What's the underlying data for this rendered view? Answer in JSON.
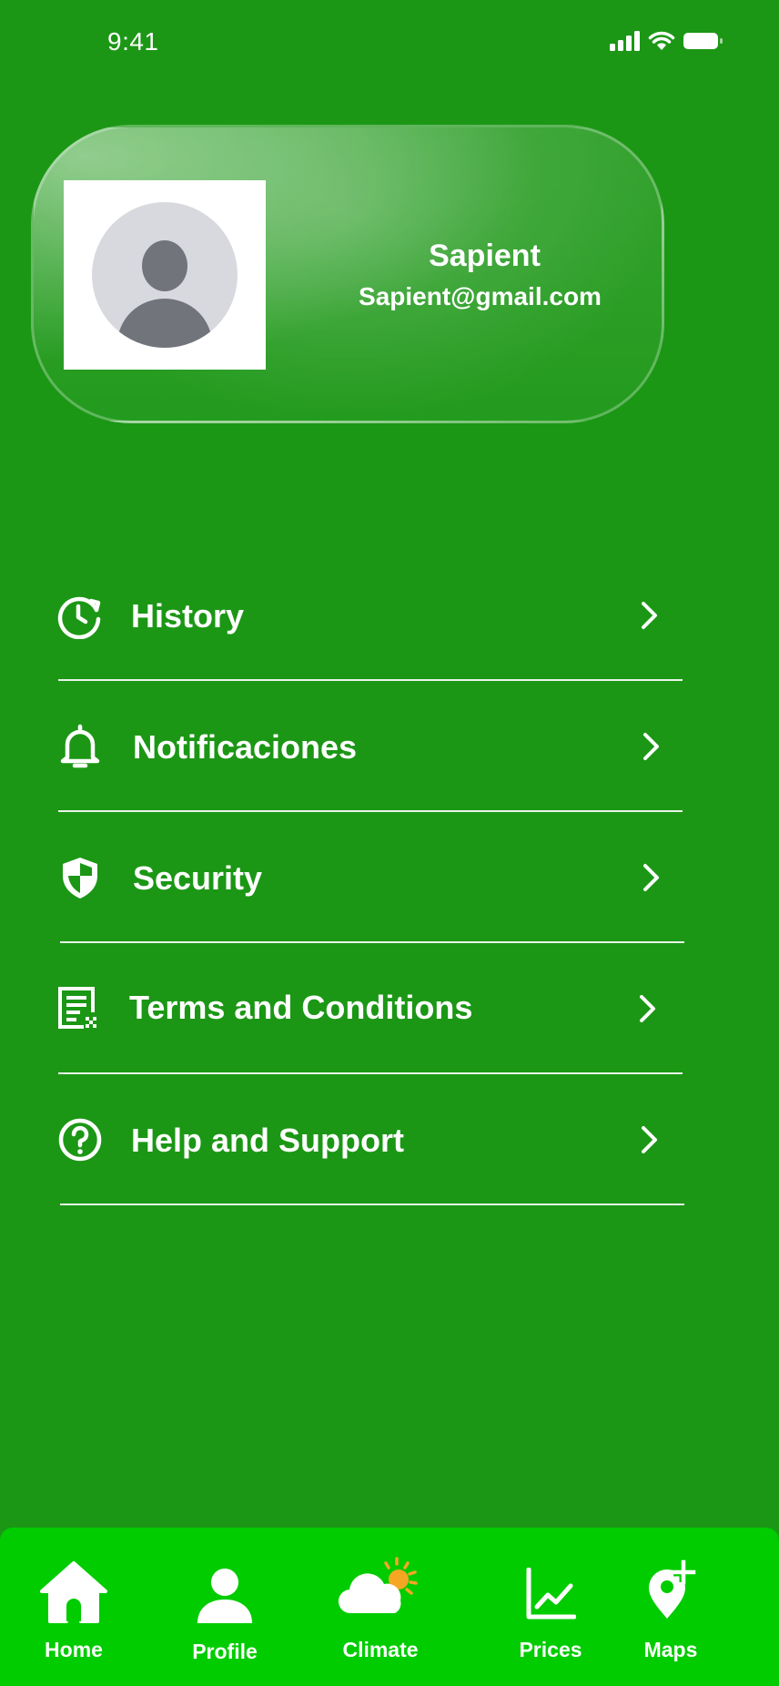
{
  "status_bar": {
    "time": "9:41"
  },
  "profile": {
    "name": "Sapient",
    "email": "Sapient@gmail.com"
  },
  "menu": [
    {
      "label": "History",
      "icon": "history-icon"
    },
    {
      "label": "Notificaciones",
      "icon": "bell-icon"
    },
    {
      "label": "Security",
      "icon": "shield-icon"
    },
    {
      "label": "Terms and  Conditions",
      "icon": "document-icon"
    },
    {
      "label": "Help and Support",
      "icon": "help-icon"
    }
  ],
  "bottom_nav": [
    {
      "label": "Home",
      "icon": "home-icon"
    },
    {
      "label": "Profile",
      "icon": "profile-icon"
    },
    {
      "label": "Climate",
      "icon": "cloud-sun-icon"
    },
    {
      "label": "Prices",
      "icon": "chart-icon"
    },
    {
      "label": "Maps",
      "icon": "map-pin-plus-icon"
    }
  ],
  "colors": {
    "background": "#1b9715",
    "nav_background": "#00cc00",
    "sun": "#f5a623",
    "avatar_bg": "#d8d9de",
    "avatar_fg": "#72747c"
  }
}
